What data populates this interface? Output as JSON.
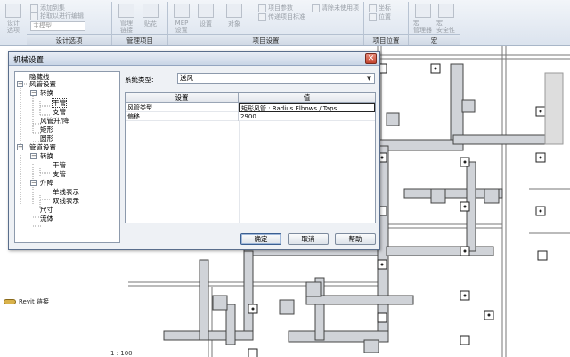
{
  "ribbon": {
    "buttons": {
      "design_option": "设计\n选项",
      "add_to_set": "添加到集",
      "pick_to_edit": "拾取以进行编辑",
      "main_model": "主模型",
      "manage_links": "管理\n链接",
      "decal_types": "贴花",
      "mep_settings": "MEP\n设置",
      "settings": "设置",
      "coordinates": "对象",
      "project_settings_a": "项目参数",
      "project_settings_b": "传递项目标准",
      "project_settings_c": "清除未使用项",
      "location_coords": "坐标",
      "location_pos": "位置",
      "macro_manager": "宏\n管理器",
      "macro_security": "宏\n安全性"
    },
    "groups": {
      "design_options": "设计选项",
      "manage_project": "管理项目",
      "project_settings": "项目设置",
      "project_location": "项目位置",
      "macros": "宏"
    }
  },
  "dialog": {
    "title": "机械设置",
    "close_glyph": "✕",
    "tree": [
      {
        "label": "隐藏线"
      },
      {
        "label": "风管设置",
        "expander": "−"
      },
      {
        "label": "转换",
        "expander": "−"
      },
      {
        "label": "干管"
      },
      {
        "label": "支管"
      },
      {
        "label": "风管升/降"
      },
      {
        "label": "矩形"
      },
      {
        "label": "圆形"
      },
      {
        "label": "管道设置",
        "expander": "−"
      },
      {
        "label": "转换",
        "expander": "−"
      },
      {
        "label": "干管"
      },
      {
        "label": "支管"
      },
      {
        "label": "升降",
        "expander": "−"
      },
      {
        "label": "单线表示"
      },
      {
        "label": "双线表示"
      },
      {
        "label": "尺寸"
      },
      {
        "label": "流体"
      }
    ],
    "system_type_label": "系统类型:",
    "system_type_value": "送风",
    "dropdown_glyph": "▼",
    "grid": {
      "headers": [
        "设置",
        "值"
      ],
      "rows": [
        {
          "setting": "风管类型",
          "value": "矩形风管 : Radius Elbows / Taps"
        },
        {
          "setting": "偏移",
          "value": "2900"
        }
      ]
    },
    "buttons": {
      "ok": "确定",
      "cancel": "取消",
      "help": "帮助"
    }
  },
  "browser": {
    "revit_links": "Revit 链接"
  },
  "status": {
    "scale": "1 : 100"
  }
}
